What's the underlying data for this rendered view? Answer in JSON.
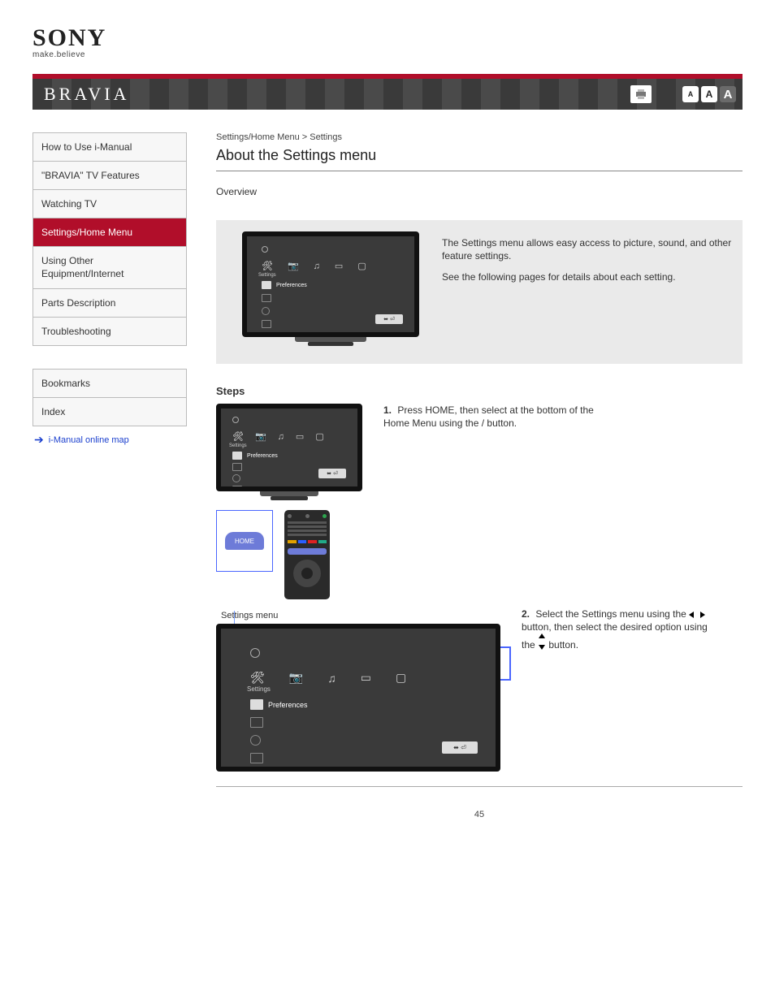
{
  "header": {
    "logo": "SONY",
    "tagline": "make.believe",
    "product": "BRAVIA",
    "font_sizes": [
      "A",
      "A",
      "A"
    ]
  },
  "sidebar": {
    "items": [
      {
        "label": "How to Use i-Manual"
      },
      {
        "label": "\"BRAVIA\" TV Features"
      },
      {
        "label": "Watching TV"
      },
      {
        "label": "Settings/Home Menu"
      },
      {
        "label": "Using Other Equipment/Internet"
      },
      {
        "label": "Parts Description"
      },
      {
        "label": "Troubleshooting"
      },
      {
        "label": "Bookmarks"
      },
      {
        "label": "Index"
      }
    ],
    "active_index": 3,
    "bookmarks_link": "i-Manual online map"
  },
  "content": {
    "crumb": "Settings/Home Menu > Settings",
    "title": "About the Settings menu",
    "overview_label": "Overview",
    "panel": {
      "p1": "The Settings menu allows easy access to picture, sound, and other feature settings.",
      "p2": "See the following pages for details about each setting.",
      "tv_ui": {
        "label_settings": "Settings",
        "label_preferences": "Preferences",
        "dpad_hint": "⬌  ⏎"
      }
    },
    "steps_label": "Steps",
    "step1": {
      "num": "1.",
      "text": "Press HOME, then select   at the bottom of the Home Menu using the  /  button.",
      "home_label": "HOME"
    },
    "step2": {
      "num": "2.",
      "text_before": "Select the Settings menu using the ",
      "text_mid": " button, then select the desired option using the ",
      "text_after": " button."
    },
    "callout_label": "Settings menu"
  },
  "page_number": "45",
  "colors": {
    "accent": "#b10e2a",
    "link": "#1a3fce",
    "callout": "#4a66ff"
  }
}
